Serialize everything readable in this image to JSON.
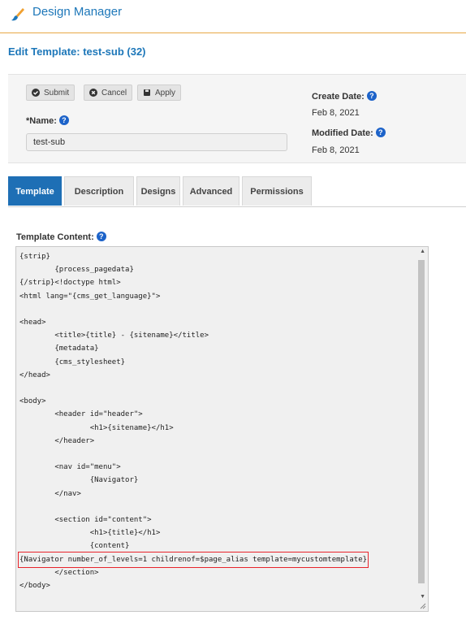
{
  "header": {
    "app_title": "Design Manager",
    "page_title": "Edit Template: test-sub (32)"
  },
  "toolbar": {
    "submit_label": "Submit",
    "cancel_label": "Cancel",
    "apply_label": "Apply"
  },
  "form": {
    "name_label": "*Name:",
    "name_value": "test-sub",
    "create_date_label": "Create Date:",
    "create_date_value": "Feb 8, 2021",
    "modified_date_label": "Modified Date:",
    "modified_date_value": "Feb 8, 2021"
  },
  "tabs": [
    {
      "label": "Template",
      "active": true
    },
    {
      "label": "Description"
    },
    {
      "label": "Designs"
    },
    {
      "label": "Advanced"
    },
    {
      "label": "Permissions"
    }
  ],
  "editor": {
    "label": "Template Content:",
    "lines": [
      "{strip}",
      "        {process_pagedata}",
      "{/strip}<!doctype html>",
      "<html lang=\"{cms_get_language}\">",
      "",
      "<head>",
      "        <title>{title} - {sitename}</title>",
      "        {metadata}",
      "        {cms_stylesheet}",
      "</head>",
      "",
      "<body>",
      "        <header id=\"header\">",
      "                <h1>{sitename}</h1>",
      "        </header>",
      "",
      "        <nav id=\"menu\">",
      "                {Navigator}",
      "        </nav>",
      "",
      "        <section id=\"content\">",
      "                <h1>{title}</h1>",
      "                {content}",
      "{Navigator number_of_levels=1 childrenof=$page_alias template=mycustomtemplate}",
      "        </section>",
      "</body>"
    ],
    "highlighted_line": 23
  },
  "colors": {
    "accent": "#1d77b9",
    "tab_active": "#1e6fb5",
    "highlight_border": "#e8242b",
    "divider": "#e8a845"
  },
  "icons": [
    "brush-icon",
    "check-circle-icon",
    "x-circle-icon",
    "save-icon",
    "help-icon"
  ]
}
